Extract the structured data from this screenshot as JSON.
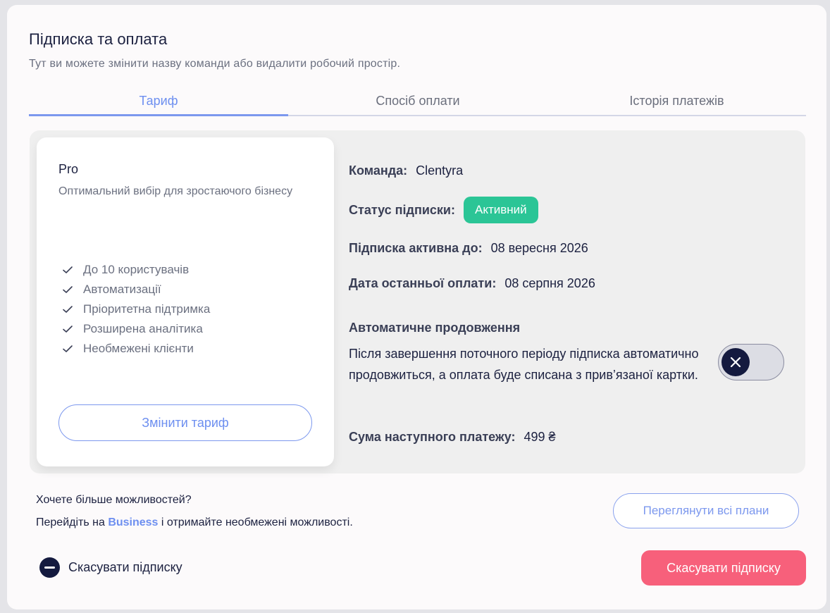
{
  "header": {
    "title": "Підписка та оплата",
    "subtitle": "Тут ви можете змінити назву команди або видалити робочий простір."
  },
  "tabs": [
    {
      "label": "Тариф",
      "active": true
    },
    {
      "label": "Спосіб оплати",
      "active": false
    },
    {
      "label": "Історія платежів",
      "active": false
    }
  ],
  "plan": {
    "name": "Pro",
    "description": "Оптимальний вибір для зростаючого бізнесу",
    "features": [
      "До 10 користувачів",
      "Автоматизації",
      "Пріоритетна підтримка",
      "Розширена аналітика",
      "Необмежені клієнти"
    ],
    "change_button": "Змінити тариф"
  },
  "details": {
    "team_label": "Команда:",
    "team_value": "Clentyra",
    "status_label": "Статус підписки:",
    "status_value": "Активний",
    "active_until_label": "Підписка активна до:",
    "active_until_value": "08 вересня 2026",
    "last_payment_label": "Дата останньої оплати:",
    "last_payment_value": "08 серпня 2026",
    "auto_renew_title": "Автоматичне продовження",
    "auto_renew_text": "Після завершення поточного періоду підписка автоматично продовжиться, а оплата буде списана з прив’язаної картки.",
    "auto_renew_enabled": false,
    "next_payment_label": "Сума наступного платежу:",
    "next_payment_value": "499 ₴"
  },
  "upsell": {
    "question": "Хочете більше можливостей?",
    "prefix": "Перейдіть на ",
    "highlight": "Business",
    "suffix": " і отримайте необмежені можливості.",
    "view_plans_button": "Переглянути всі плани"
  },
  "footer": {
    "cancel_link": "Скасувати підписку",
    "cancel_button": "Скасувати підписку"
  },
  "colors": {
    "accent": "#6d8ff0",
    "success": "#2bc596",
    "danger": "#f7607b",
    "dark": "#141a3f"
  }
}
